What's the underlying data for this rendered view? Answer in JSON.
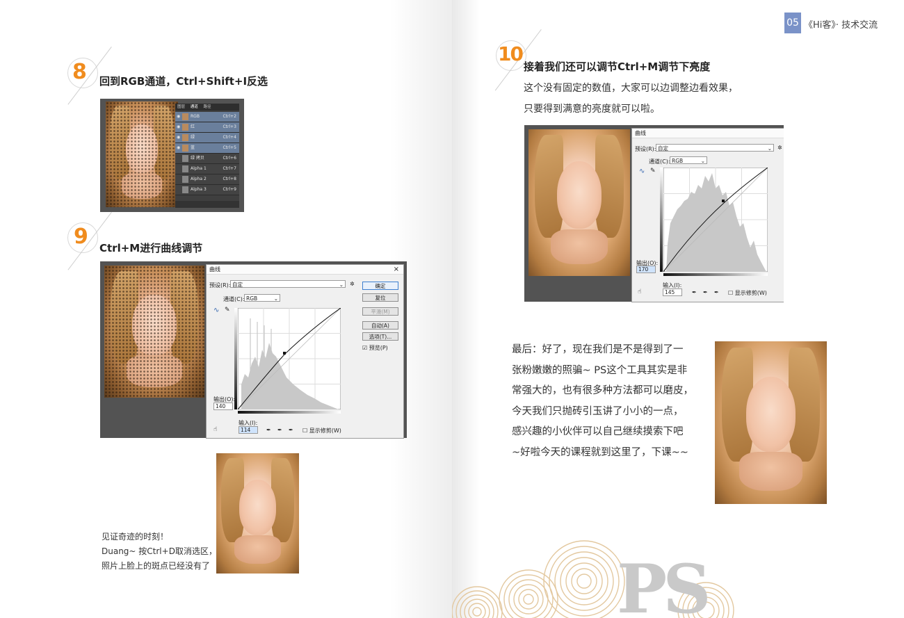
{
  "header": {
    "page_number": "05",
    "title": "《Hi客》· 技术交流",
    "accent_color": "#7a92c8"
  },
  "step8": {
    "number": "8",
    "title": "回到RGB通道，Ctrl+Shift+I反选",
    "channels_panel": {
      "tabs": [
        "图层",
        "通道",
        "路径"
      ],
      "rows": [
        {
          "name": "RGB",
          "shortcut": "Ctrl+2"
        },
        {
          "name": "红",
          "shortcut": "Ctrl+3"
        },
        {
          "name": "绿",
          "shortcut": "Ctrl+4"
        },
        {
          "name": "蓝",
          "shortcut": "Ctrl+5"
        },
        {
          "name": "绿 拷贝",
          "shortcut": "Ctrl+6"
        },
        {
          "name": "Alpha 1",
          "shortcut": "Ctrl+7"
        },
        {
          "name": "Alpha 2",
          "shortcut": "Ctrl+8"
        },
        {
          "name": "Alpha 3",
          "shortcut": "Ctrl+9"
        }
      ]
    }
  },
  "step9": {
    "number": "9",
    "title": "Ctrl+M进行曲线调节",
    "dialog": {
      "title": "曲线",
      "preset_label": "预设(R):",
      "preset_value": "自定",
      "channel_label": "通道(C):",
      "channel_value": "RGB",
      "output_label": "输出(O):",
      "output_value": "140",
      "input_label": "输入(I):",
      "input_value": "114",
      "show_clipping": "显示修剪(W)",
      "buttons": {
        "ok": "确定",
        "reset": "复位",
        "smooth": "平滑(M)",
        "auto": "自动(A)",
        "options": "选项(T)...",
        "preview": "预览(P)"
      }
    }
  },
  "miracle_caption": {
    "line1": "见证奇迹的时刻！",
    "line2": "Duang~ 按Ctrl+D取消选区，",
    "line3": "照片上脸上的斑点已经没有了"
  },
  "step10": {
    "number": "10",
    "title": "接着我们还可以调节Ctrl+M调节下亮度",
    "line1": "这个没有固定的数值，大家可以边调整边看效果，",
    "line2": "只要得到满意的亮度就可以啦。",
    "dialog": {
      "title": "曲线",
      "preset_label": "预设(R):",
      "preset_value": "自定",
      "channel_label": "通道(C):",
      "channel_value": "RGB",
      "output_label": "输出(O):",
      "output_value": "170",
      "input_label": "输入(I):",
      "input_value": "145",
      "show_clipping": "显示修剪(W)"
    }
  },
  "final": {
    "lines": [
      "最后：好了，现在我们是不是得到了一",
      "张粉嫩嫩的照骗~ PS这个工具其实是非",
      "常强大的，也有很多种方法都可以磨皮，",
      "今天我们只抛砖引玉讲了小小的一点，",
      "感兴趣的小伙伴可以自己继续摸索下吧",
      "~好啦今天的课程就到这里了，下课~~"
    ]
  },
  "footer_logo": "PS",
  "colors": {
    "step_number": "#f08c1e",
    "ps_dark": "#535353",
    "ring": "#e3c89f"
  }
}
